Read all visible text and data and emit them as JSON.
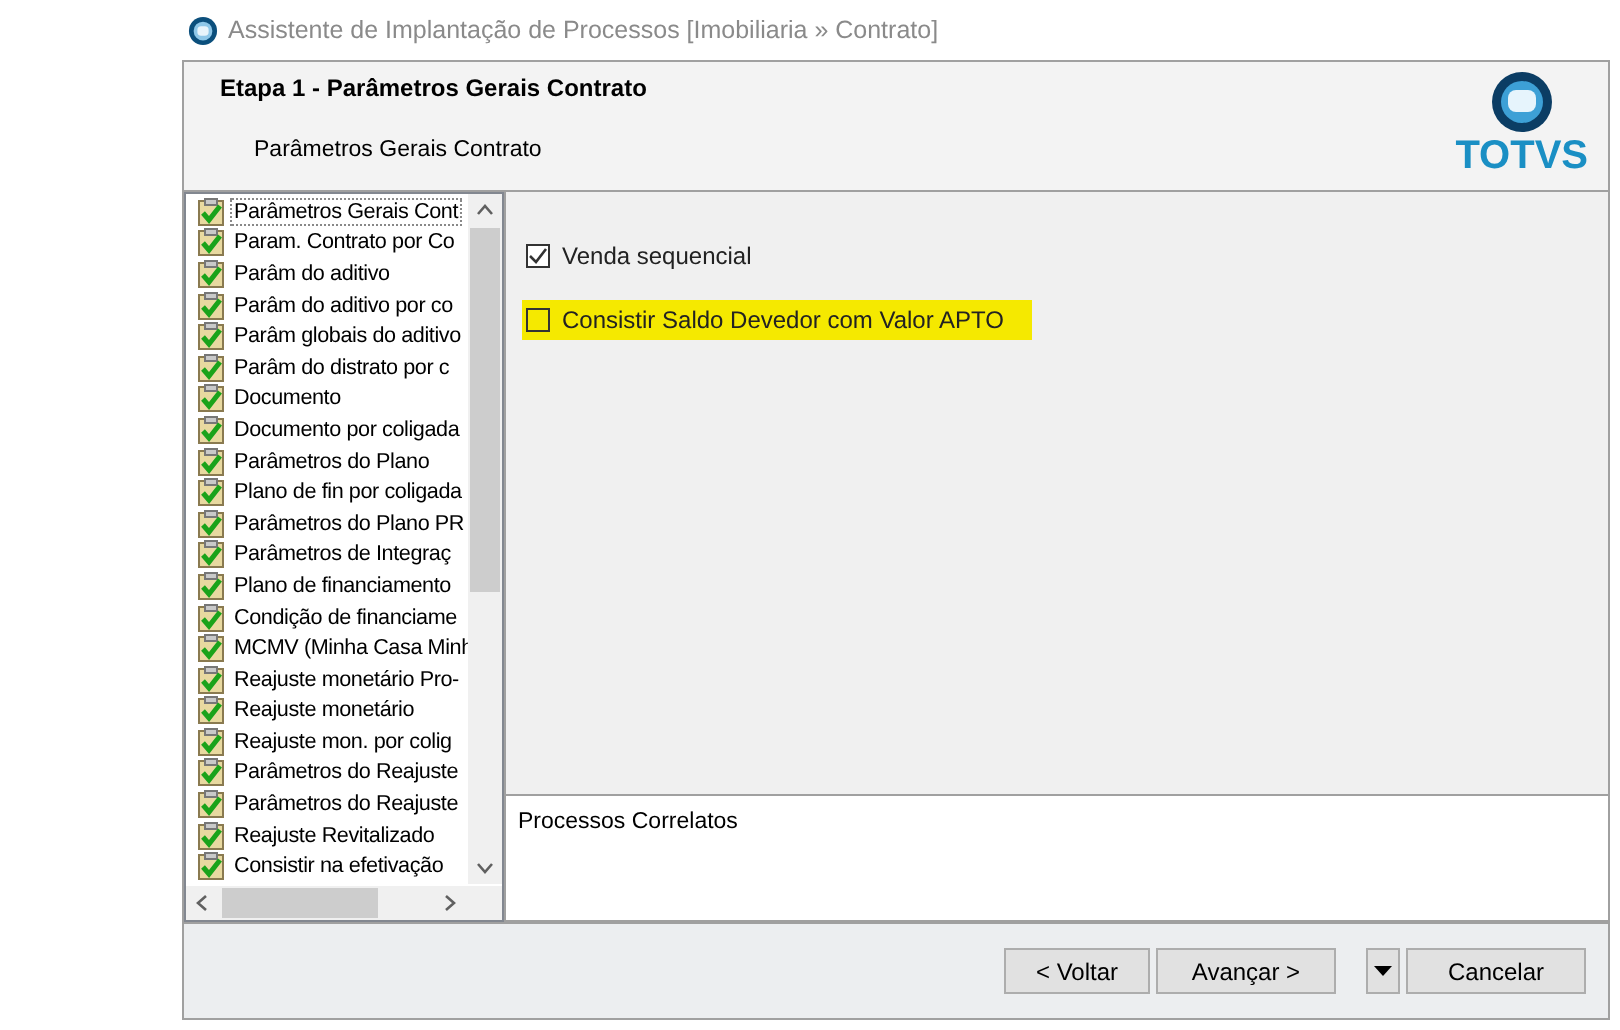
{
  "window": {
    "title": "Assistente de Implantação de Processos [Imobiliaria » Contrato]"
  },
  "header": {
    "title": "Etapa 1 - Parâmetros Gerais Contrato",
    "subtitle": "Parâmetros Gerais Contrato",
    "logo": "TOTVS"
  },
  "steps": [
    {
      "label": "Parâmetros Gerais Cont",
      "selected": true
    },
    {
      "label": "Param. Contrato por Co",
      "selected": false
    },
    {
      "label": "Parâm do aditivo",
      "selected": false
    },
    {
      "label": "Parâm do aditivo por co",
      "selected": false
    },
    {
      "label": "Parâm globais do aditivo",
      "selected": false
    },
    {
      "label": "Parâm do distrato por c",
      "selected": false
    },
    {
      "label": "Documento",
      "selected": false
    },
    {
      "label": "Documento por coligada",
      "selected": false
    },
    {
      "label": "Parâmetros do Plano",
      "selected": false
    },
    {
      "label": "Plano de fin por coligada",
      "selected": false
    },
    {
      "label": "Parâmetros do Plano PR",
      "selected": false
    },
    {
      "label": "Parâmetros de Integraç",
      "selected": false
    },
    {
      "label": "Plano de financiamento",
      "selected": false
    },
    {
      "label": "Condição de financiame",
      "selected": false
    },
    {
      "label": "MCMV (Minha Casa Minh",
      "selected": false
    },
    {
      "label": "Reajuste monetário Pro-",
      "selected": false
    },
    {
      "label": "Reajuste monetário",
      "selected": false
    },
    {
      "label": "Reajuste mon. por colig",
      "selected": false
    },
    {
      "label": "Parâmetros do Reajuste",
      "selected": false
    },
    {
      "label": "Parâmetros do Reajuste",
      "selected": false
    },
    {
      "label": "Reajuste Revitalizado",
      "selected": false
    },
    {
      "label": "Consistir na efetivação",
      "selected": false
    }
  ],
  "options": [
    {
      "label": "Venda sequencial",
      "checked": true,
      "highlighted": false
    },
    {
      "label": "Consistir Saldo Devedor com Valor APTO",
      "checked": false,
      "highlighted": true
    }
  ],
  "related": {
    "title": "Processos Correlatos"
  },
  "buttons": [
    {
      "label": "< Voltar",
      "kind": "button"
    },
    {
      "label": "Avançar >",
      "kind": "button"
    },
    {
      "kind": "dropdown"
    },
    {
      "label": "Cancelar",
      "kind": "button"
    }
  ]
}
